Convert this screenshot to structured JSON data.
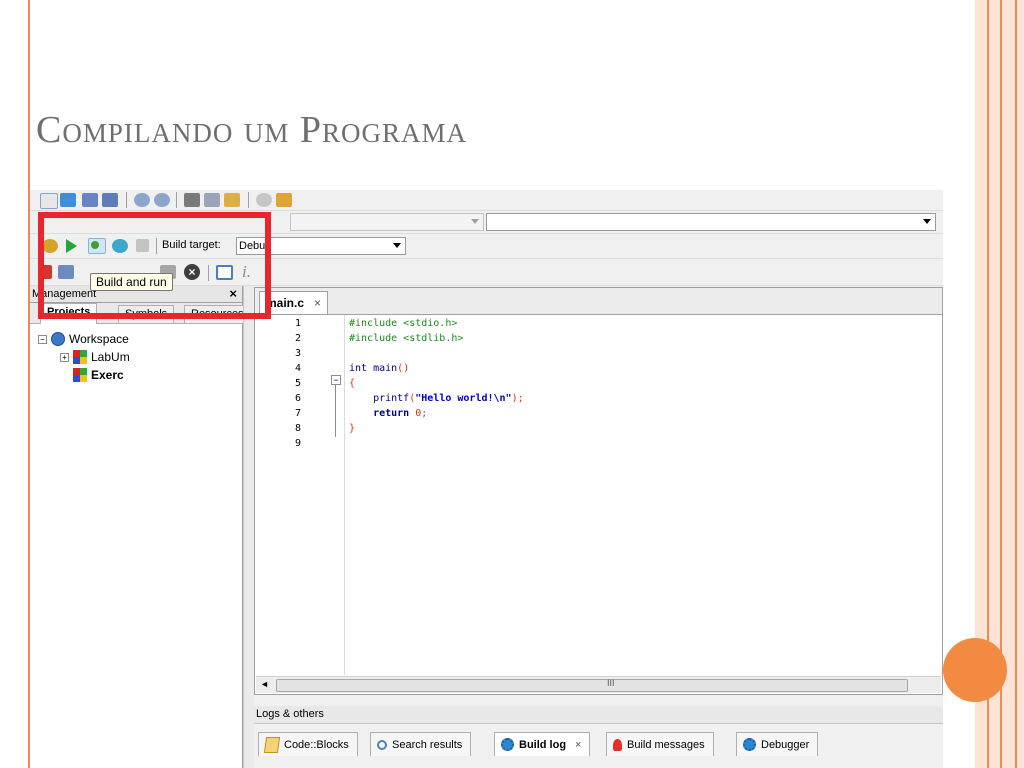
{
  "slide": {
    "title": "Compilando um Programa",
    "colors": {
      "accent": "#ec8a5c",
      "dot": "#f28a42",
      "highlight": "#e8262d"
    }
  },
  "toolbar": {
    "build_target_label": "Build target:",
    "build_target_value": "Debug",
    "tooltip": "Build and run",
    "icons": [
      "build-gear-icon",
      "run-icon",
      "build-and-run-icon",
      "rebuild-icon",
      "abort-icon"
    ]
  },
  "management": {
    "title": "Management",
    "close": "×",
    "tabs": [
      "Projects",
      "Symbols",
      "Resources"
    ],
    "tree": {
      "workspace": "Workspace",
      "projects": [
        "LabUm",
        "Exerc"
      ]
    }
  },
  "editor": {
    "tab_label": "main.c",
    "tab_close": "×",
    "line_numbers": [
      "1",
      "2",
      "3",
      "4",
      "5",
      "6",
      "7",
      "8",
      "9"
    ],
    "code": {
      "l1": "#include <stdio.h>",
      "l2": "#include <stdlib.h>",
      "l4a": "int",
      "l4b": " main",
      "l4c": "()",
      "l5": "{",
      "l6a": "    printf",
      "l6b": "(",
      "l6c": "\"Hello world!\\n\"",
      "l6d": ");",
      "l7a": "    return",
      "l7b": " 0",
      "l7c": ";",
      "l8": "}"
    },
    "scroll_grip": "III"
  },
  "logs": {
    "title": "Logs & others",
    "tabs": [
      "Code::Blocks",
      "Search results",
      "Build log",
      "Build messages",
      "Debugger"
    ],
    "close": "×"
  }
}
